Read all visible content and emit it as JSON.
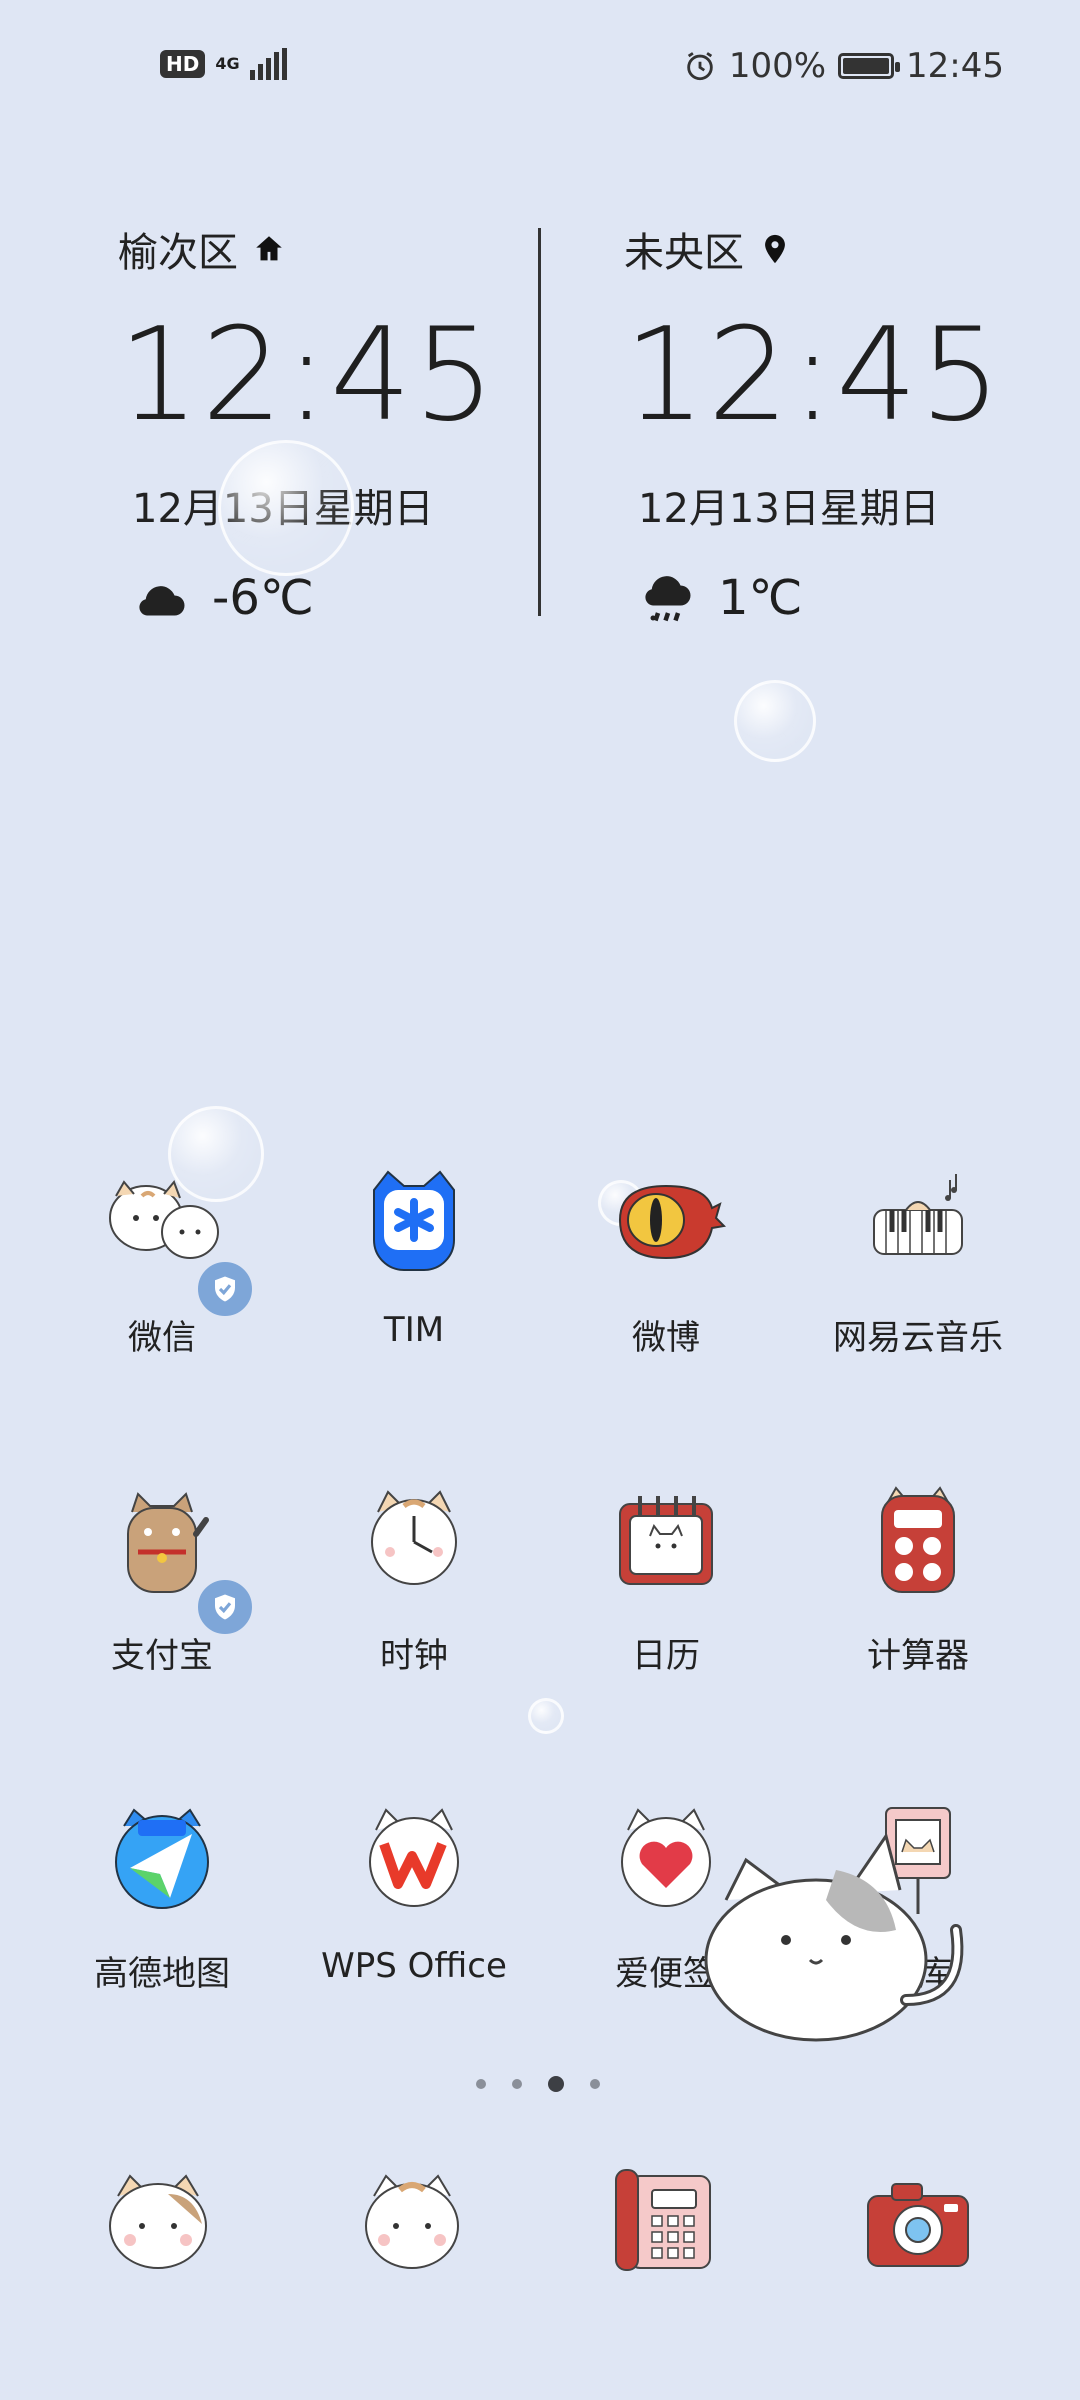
{
  "status_bar": {
    "hd": "HD",
    "network": "4G",
    "battery": "100%",
    "battery_level": 1.0,
    "time": "12:45"
  },
  "clocks": [
    {
      "city": "榆次区",
      "city_icon": "home-icon",
      "time": "12:45",
      "date": "12月13日星期日",
      "weather_icon": "cloud-icon",
      "temp": "-6℃"
    },
    {
      "city": "未央区",
      "city_icon": "location-pin-icon",
      "time": "12:45",
      "date": "12月13日星期日",
      "weather_icon": "cloud-snow-icon",
      "temp": "1℃"
    }
  ],
  "apps": [
    {
      "label": "微信"
    },
    {
      "label": "TIM"
    },
    {
      "label": "微博"
    },
    {
      "label": "网易云音乐"
    },
    {
      "label": "支付宝"
    },
    {
      "label": "时钟"
    },
    {
      "label": "日历"
    },
    {
      "label": "计算器"
    },
    {
      "label": "高德地图"
    },
    {
      "label": "WPS Office"
    },
    {
      "label": "爱便签"
    },
    {
      "label": "图库"
    }
  ],
  "page_indicator": {
    "pages": 4,
    "current": 3
  },
  "dock": [
    {
      "name": "cat-messages-icon"
    },
    {
      "name": "cat-contacts-icon"
    },
    {
      "name": "phone-icon"
    },
    {
      "name": "camera-icon"
    }
  ],
  "colors": {
    "wallpaper": "#dfe6f4",
    "tim_blue": "#1f6ff5",
    "weibo_red": "#c93a2e"
  }
}
